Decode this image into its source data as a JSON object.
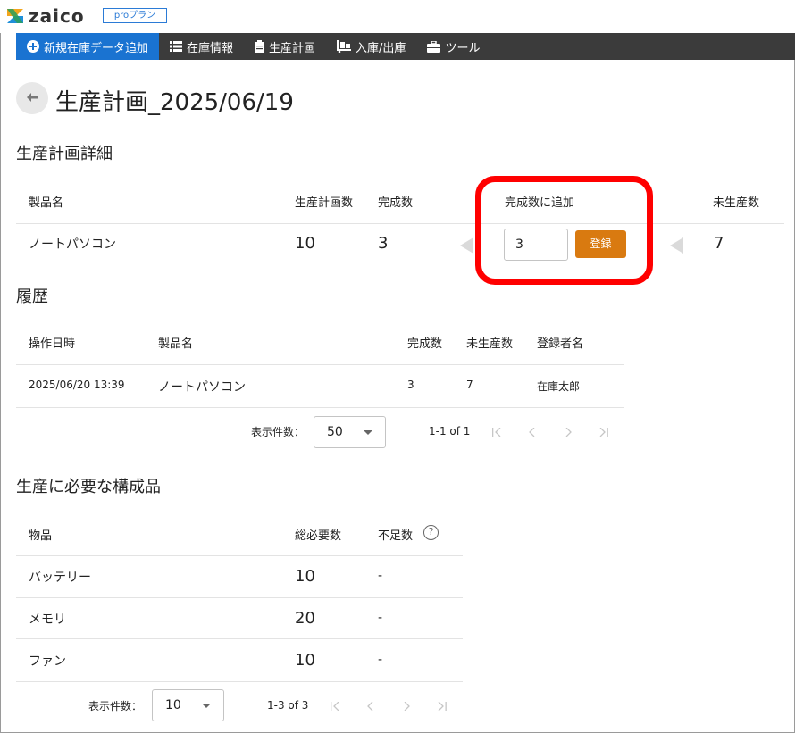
{
  "header": {
    "logo_text": "zaico",
    "plan_badge": "proプラン"
  },
  "nav": {
    "items": [
      {
        "label": "新規在庫データ追加",
        "icon": "plus-circle-icon",
        "active": true
      },
      {
        "label": "在庫情報",
        "icon": "list-icon",
        "active": false
      },
      {
        "label": "生産計画",
        "icon": "clipboard-icon",
        "active": false
      },
      {
        "label": "入庫/出庫",
        "icon": "dolly-icon",
        "active": false
      },
      {
        "label": "ツール",
        "icon": "toolbox-icon",
        "active": false
      }
    ]
  },
  "page": {
    "back_icon": "arrow-left-icon",
    "title": "生産計画_2025/06/19"
  },
  "detail": {
    "section_title": "生産計画詳細",
    "columns": {
      "product": "製品名",
      "planned": "生産計画数",
      "completed": "完成数",
      "add_completed": "完成数に追加",
      "remaining": "未生産数"
    },
    "row": {
      "product": "ノートパソコン",
      "planned": "10",
      "completed": "3",
      "add_value": "3",
      "remaining": "7"
    },
    "register_label": "登録",
    "highlight_color": "#ff0000"
  },
  "history": {
    "section_title": "履歴",
    "columns": {
      "datetime": "操作日時",
      "product": "製品名",
      "completed": "完成数",
      "remaining": "未生産数",
      "user": "登録者名"
    },
    "rows": [
      {
        "datetime": "2025/06/20 13:39",
        "product": "ノートパソコン",
        "completed": "3",
        "remaining": "7",
        "user": "在庫太郎"
      }
    ],
    "pager": {
      "per_page_label": "表示件数：",
      "per_page_value": "50",
      "range": "1-1 of 1"
    }
  },
  "components": {
    "section_title": "生産に必要な構成品",
    "columns": {
      "item": "物品",
      "required": "総必要数",
      "shortage": "不足数"
    },
    "rows": [
      {
        "item": "バッテリー",
        "required": "10",
        "shortage": "-"
      },
      {
        "item": "メモリ",
        "required": "20",
        "shortage": "-"
      },
      {
        "item": "ファン",
        "required": "10",
        "shortage": "-"
      }
    ],
    "pager": {
      "per_page_label": "表示件数：",
      "per_page_value": "10",
      "range": "1-3 of 3"
    }
  },
  "colors": {
    "nav_bg": "#3b3b3b",
    "nav_active": "#1a73d1",
    "register_button": "#d97a10",
    "accent_blue": "#2b7bd6"
  }
}
